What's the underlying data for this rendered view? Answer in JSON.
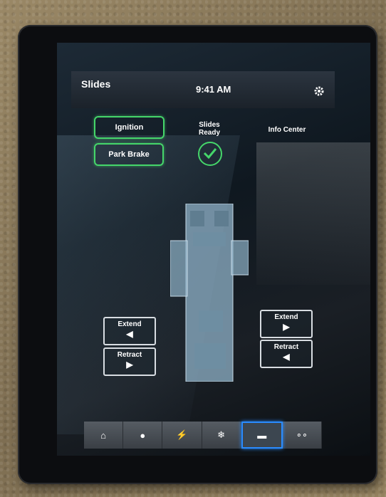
{
  "header": {
    "title": "Slides",
    "time": "9:41 AM",
    "settings_icon": "gear-icon"
  },
  "interlocks": {
    "ignition_label": "Ignition",
    "park_brake_label": "Park Brake"
  },
  "status": {
    "slides_ready_label": "Slides Ready",
    "info_center_label": "Info Center",
    "ready_icon": "check-circle-icon"
  },
  "slide_controls": {
    "left": {
      "extend_label": "Extend",
      "retract_label": "Retract"
    },
    "right": {
      "extend_label": "Extend",
      "retract_label": "Retract"
    }
  },
  "nav": {
    "items": [
      {
        "icon": "home-icon",
        "glyph": "⌂"
      },
      {
        "icon": "lightbulb-icon",
        "glyph": "●"
      },
      {
        "icon": "power-bolt-icon",
        "glyph": "⚡"
      },
      {
        "icon": "snowflake-icon",
        "glyph": "❄"
      },
      {
        "icon": "rv-slides-icon",
        "glyph": "▬",
        "active": true
      },
      {
        "icon": "more-icon",
        "glyph": "∘∘"
      }
    ]
  },
  "colors": {
    "accent_green": "#45d66a",
    "active_blue": "#2a8cff"
  }
}
